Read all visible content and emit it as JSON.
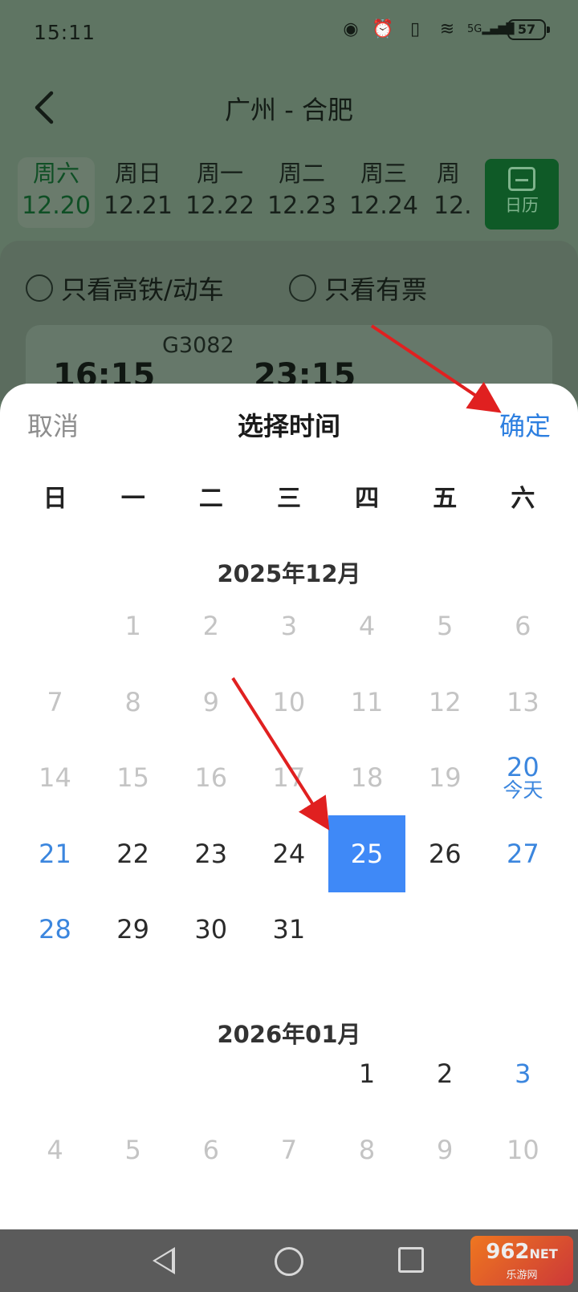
{
  "status_bar": {
    "time": "15:11",
    "battery": "57",
    "network": "5G"
  },
  "nav": {
    "title": "广州 - 合肥"
  },
  "date_strip": [
    {
      "weekday": "周六",
      "date": "12.20",
      "selected": true
    },
    {
      "weekday": "周日",
      "date": "12.21"
    },
    {
      "weekday": "周一",
      "date": "12.22"
    },
    {
      "weekday": "周二",
      "date": "12.23"
    },
    {
      "weekday": "周三",
      "date": "12.24"
    },
    {
      "weekday": "周",
      "date": "12."
    }
  ],
  "calendar_button": {
    "label": "日历"
  },
  "filters": [
    {
      "label": "只看高铁/动车"
    },
    {
      "label": "只看有票"
    }
  ],
  "train_card": {
    "code": "G3082",
    "depart": "16:15",
    "arrive": "23:15"
  },
  "sheet": {
    "cancel": "取消",
    "title": "选择时间",
    "confirm": "确定",
    "weekdays": [
      "日",
      "一",
      "二",
      "三",
      "四",
      "五",
      "六"
    ],
    "months": [
      {
        "title": "2025年12月"
      },
      {
        "title": "2026年01月"
      }
    ],
    "today_label": "今天",
    "selected_day": "25"
  },
  "colors": {
    "accent": "#3f89f7",
    "weekend": "#3b86de",
    "confirm": "#2d7fe0",
    "annotation": "#e02020"
  },
  "watermark": {
    "text": "962",
    "suffix": "NET",
    "sub": "乐游网"
  }
}
